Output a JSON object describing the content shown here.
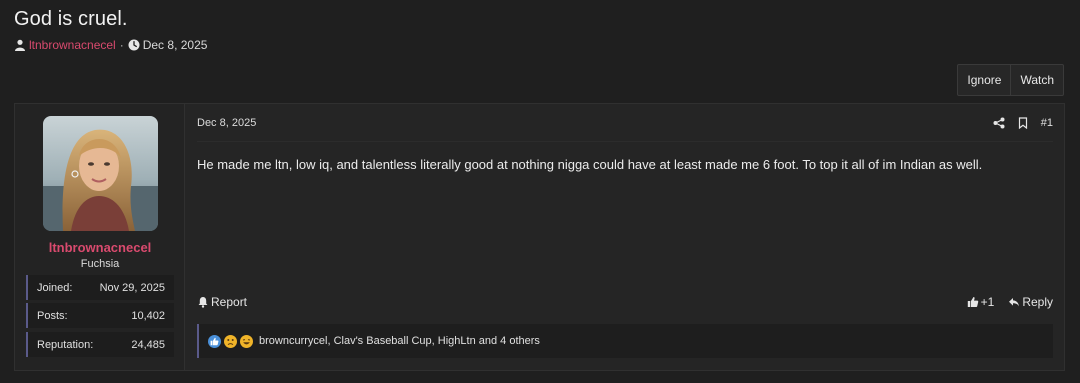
{
  "thread": {
    "title": "God is cruel.",
    "author": "ltnbrownacnecel",
    "separator": "·",
    "date": "Dec 8, 2025"
  },
  "actions": {
    "ignore_label": "Ignore",
    "watch_label": "Watch"
  },
  "post": {
    "user": {
      "name": "ltnbrownacnecel",
      "title": "Fuchsia",
      "stats": [
        {
          "label": "Joined:",
          "value": "Nov 29, 2025"
        },
        {
          "label": "Posts:",
          "value": "10,402"
        },
        {
          "label": "Reputation:",
          "value": "24,485"
        }
      ]
    },
    "date": "Dec 8, 2025",
    "number": "#1",
    "body": "He made me ltn, low iq, and talentless literally good at nothing nigga could have at least made me 6 foot. To top it all of im Indian as well.",
    "report_label": "Report",
    "like_label": "+1",
    "reply_label": "Reply",
    "reactions_text": "browncurrycel, Clav's Baseball Cup, HighLtn and 4 others"
  },
  "colors": {
    "accent": "#d94a6e",
    "background": "#1f1f1f",
    "panel": "#252525",
    "stat_border": "#5a5a8a"
  },
  "icons": [
    "user-icon",
    "clock-icon",
    "share-icon",
    "bookmark-icon",
    "bell-icon",
    "thumbs-up-icon",
    "reply-icon",
    "like-reaction-icon",
    "sad-reaction-icon",
    "laugh-reaction-icon"
  ]
}
